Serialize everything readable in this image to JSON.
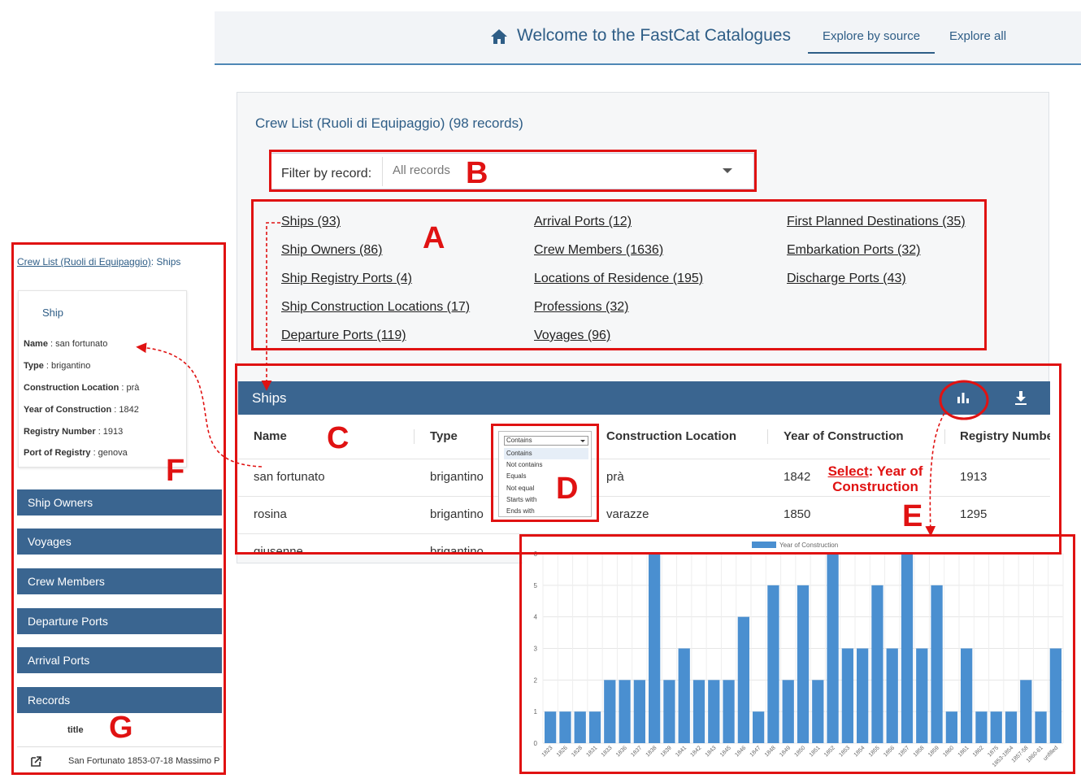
{
  "header": {
    "welcome": "Welcome to the FastCat Catalogues",
    "nav": [
      "Explore by source",
      "Explore all"
    ]
  },
  "catalogue": {
    "title": "Crew List (Ruoli di Equipaggio) (98 records)",
    "filter_label": "Filter by record:",
    "filter_value": "All records",
    "links": [
      "Ships (93)",
      "Ship Owners (86)",
      "Ship Registry Ports (4)",
      "Ship Construction Locations (17)",
      "Departure Ports (119)",
      "Arrival Ports (12)",
      "Crew Members (1636)",
      "Locations of Residence (195)",
      "Professions (32)",
      "Voyages (96)",
      "First Planned Destinations (35)",
      "Embarkation Ports (32)",
      "Discharge Ports (43)"
    ]
  },
  "ships": {
    "title": "Ships",
    "columns": [
      "Name",
      "Type",
      "Construction Location",
      "Year of Construction",
      "Registry Numbe"
    ],
    "rows": [
      [
        "san fortunato",
        "brigantino",
        "prà",
        "1842",
        "1913"
      ],
      [
        "rosina",
        "brigantino",
        "varazze",
        "1850",
        "1295"
      ],
      [
        "giusenne",
        "brigantino",
        "",
        "",
        ""
      ]
    ]
  },
  "filter_menu": {
    "selected": "Contains",
    "options": [
      "Contains",
      "Not contains",
      "Equals",
      "Not equal",
      "Starts with",
      "Ends with"
    ]
  },
  "sidebar": {
    "crumb_link": "Crew List (Ruoli di Equipaggio)",
    "crumb_tail": ": Ships",
    "card_heading": "Ship",
    "fields": [
      {
        "label": "Name",
        "value": " : san fortunato"
      },
      {
        "label": "Type",
        "value": " : brigantino"
      },
      {
        "label": "Construction Location",
        "value": " : prà"
      },
      {
        "label": "Year of Construction",
        "value": " : 1842"
      },
      {
        "label": "Registry Number",
        "value": " : 1913"
      },
      {
        "label": "Port of Registry",
        "value": " : genova"
      }
    ],
    "items": [
      "Ship Owners",
      "Voyages",
      "Crew Members",
      "Departure Ports",
      "Arrival Ports",
      "Records"
    ],
    "records_column": "title",
    "record_row": "San Fortunato 1853-07-18 Massimo P"
  },
  "annotations": {
    "letters": [
      "A",
      "B",
      "C",
      "D",
      "E",
      "F",
      "G"
    ],
    "select_word": "Select",
    "select_rest": ": Year of Construction"
  },
  "chart_data": {
    "type": "bar",
    "legend": "Year of Construction",
    "categories": [
      "1823",
      "1826",
      "1828",
      "1831",
      "1833",
      "1836",
      "1837",
      "1838",
      "1839",
      "1841",
      "1842",
      "1843",
      "1845",
      "1846",
      "1847",
      "1848",
      "1849",
      "1850",
      "1851",
      "1852",
      "1853",
      "1854",
      "1855",
      "1856",
      "1857",
      "1858",
      "1859",
      "1860",
      "1861",
      "1862",
      "1875",
      "1853-1854",
      "1857-58",
      "1860-61",
      "unfilled"
    ],
    "values": [
      1,
      1,
      1,
      1,
      2,
      2,
      2,
      6,
      2,
      3,
      2,
      2,
      2,
      4,
      1,
      5,
      2,
      5,
      2,
      6,
      3,
      3,
      5,
      3,
      6,
      3,
      5,
      1,
      3,
      1,
      1,
      1,
      2,
      1,
      3
    ],
    "ylim": [
      0,
      6
    ],
    "yticks": [
      0,
      1,
      2,
      3,
      4,
      5,
      6
    ],
    "bar_color": "#4a8fd0",
    "grid": true,
    "legend_position": "top"
  },
  "colors": {
    "annotation": "#e01212",
    "primary": "#3a6590",
    "accent": "#2e5d86"
  }
}
